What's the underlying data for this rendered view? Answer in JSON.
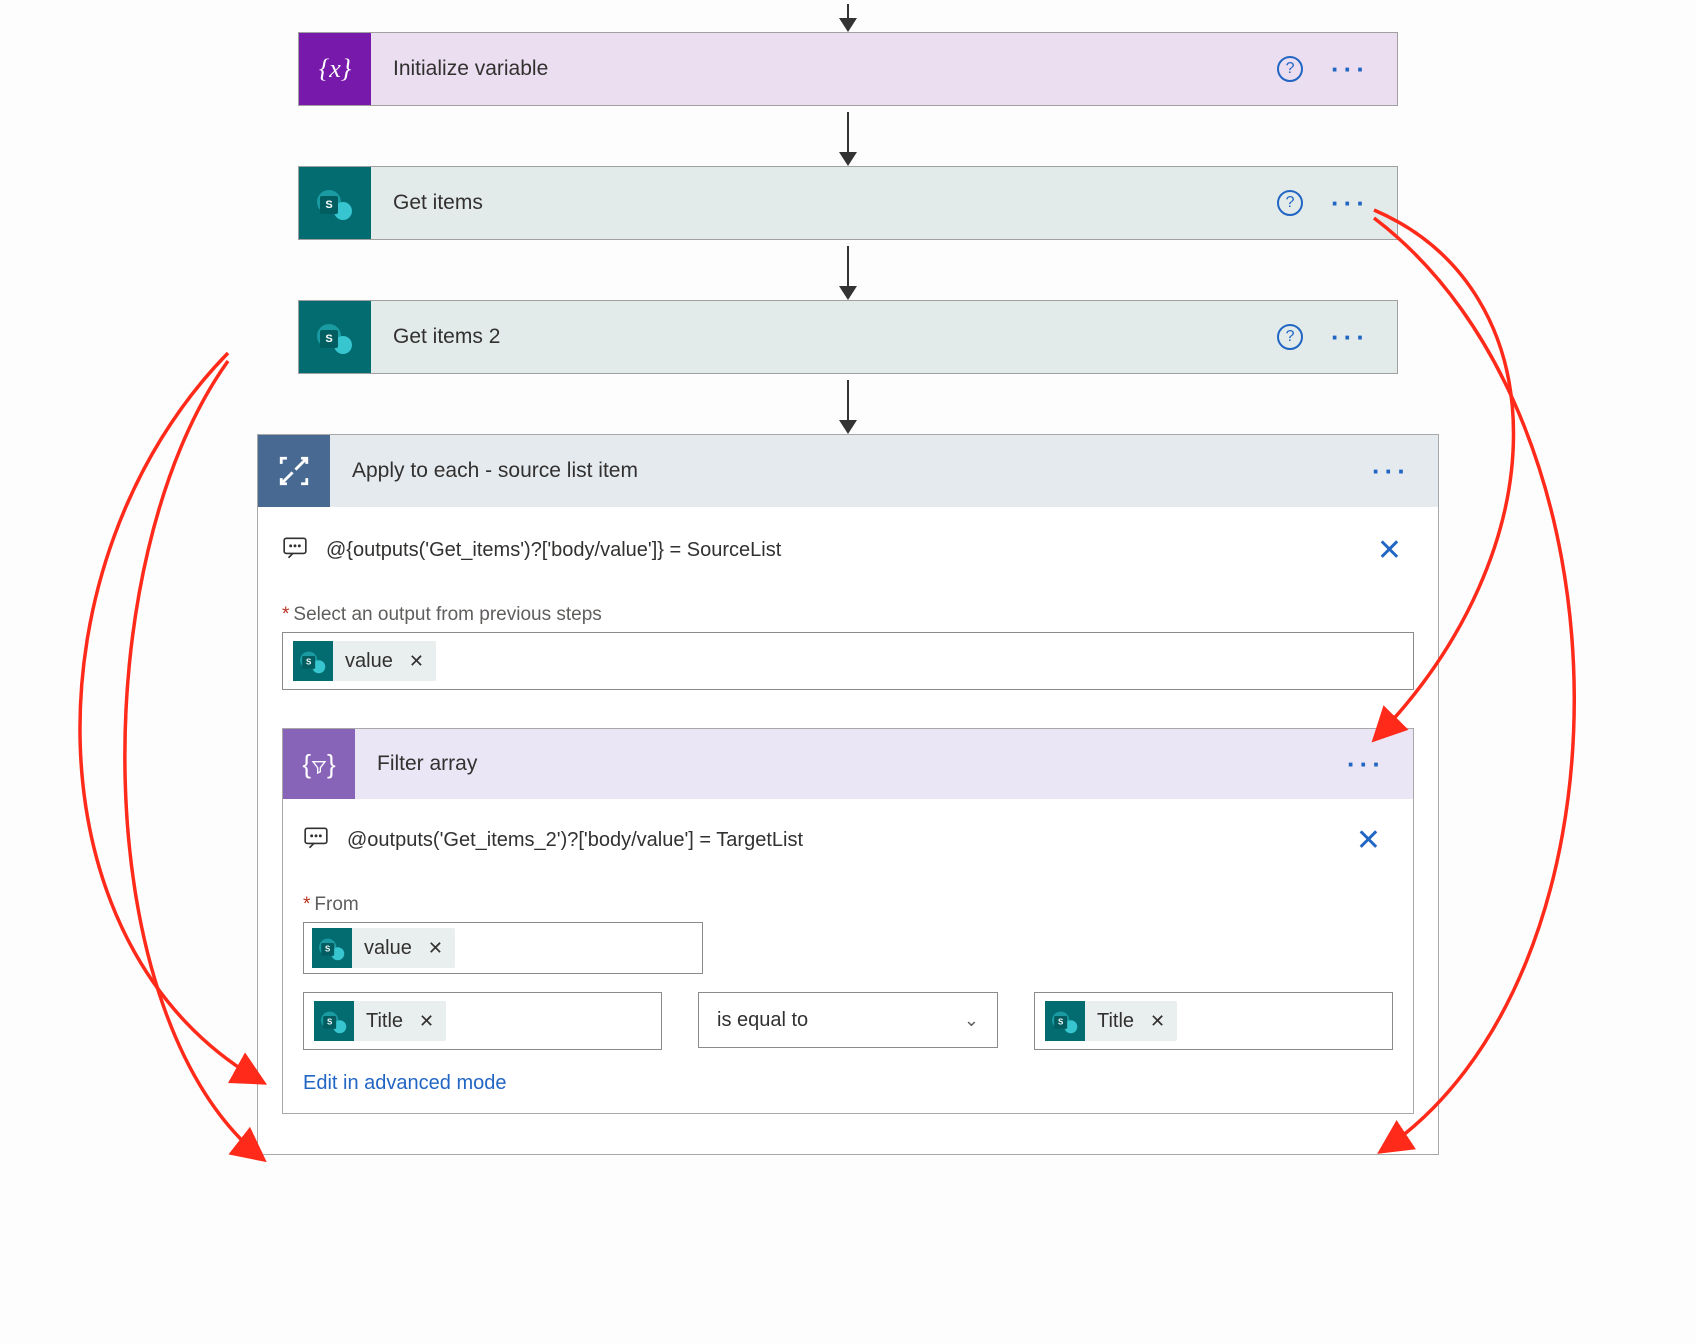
{
  "colors": {
    "purple": "#7719aa",
    "teal": "#036c70",
    "slate": "#486991",
    "violet": "#8764b8",
    "link": "#2266c4",
    "annotation": "#ff2a1a"
  },
  "steps": {
    "init_var": {
      "label": "Initialize variable"
    },
    "get_items": {
      "label": "Get items"
    },
    "get_items_2": {
      "label": "Get items 2"
    }
  },
  "apply_each": {
    "title": "Apply to each - source list item",
    "comment": "@{outputs('Get_items')?['body/value']} = SourceList",
    "select_label": "Select an output from previous steps",
    "token_value": "value"
  },
  "filter": {
    "title": "Filter array",
    "comment": "@outputs('Get_items_2')?['body/value'] = TargetList",
    "from_label": "From",
    "token_value": "value",
    "left_token": "Title",
    "operator": "is equal to",
    "right_token": "Title",
    "advanced_link": "Edit in advanced mode"
  }
}
